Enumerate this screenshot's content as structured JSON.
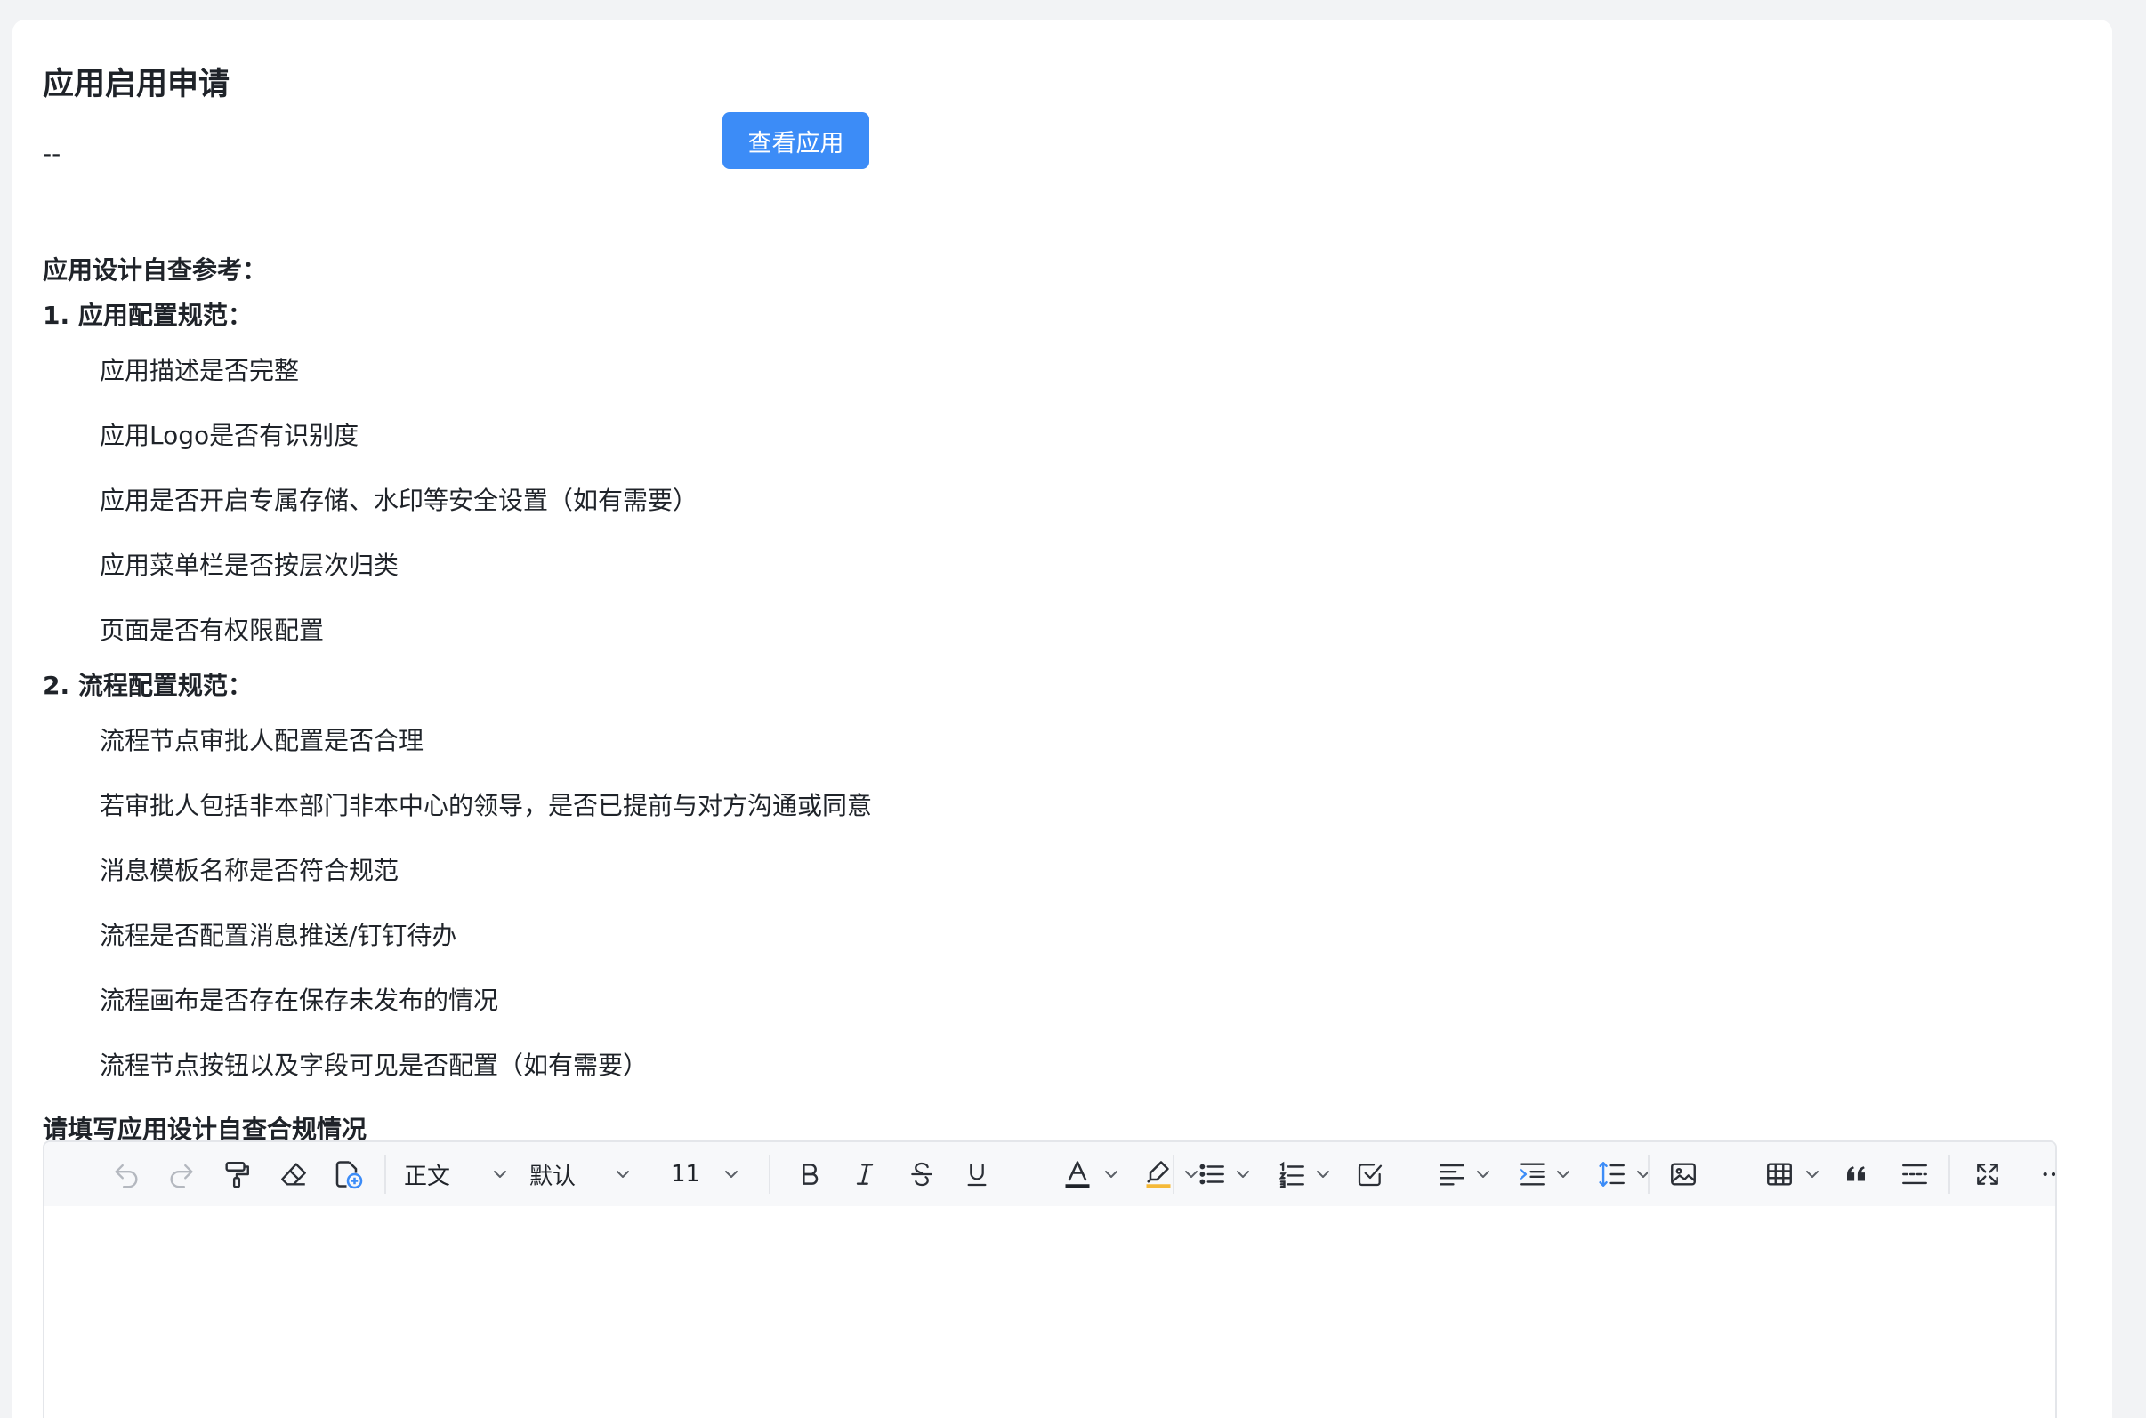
{
  "page": {
    "title": "应用启用申请",
    "app_value": "--",
    "view_button_label": "查看应用"
  },
  "checklist": {
    "heading": "应用设计自查参考：",
    "sections": [
      {
        "title": "1. 应用配置规范：",
        "items": [
          "应用描述是否完整",
          "应用Logo是否有识别度",
          "应用是否开启专属存储、水印等安全设置（如有需要）",
          "应用菜单栏是否按层次归类",
          "页面是否有权限配置"
        ]
      },
      {
        "title": "2. 流程配置规范：",
        "items": [
          "流程节点审批人配置是否合理",
          "若审批人包括非本部门非本中心的领导，是否已提前与对方沟通或同意",
          "消息模板名称是否符合规范",
          "流程是否配置消息推送/钉钉待办",
          "流程画布是否存在保存未发布的情况",
          "流程节点按钮以及字段可见是否配置（如有需要）"
        ]
      }
    ]
  },
  "form": {
    "field_label": "请填写应用设计自查合规情况"
  },
  "editor_toolbar": {
    "paragraph_style": "正文",
    "font_family": "默认",
    "font_size": "11",
    "text_color": "#1f2329",
    "highlight_color": "#f5b938"
  },
  "colors": {
    "primary": "#3c8cf7",
    "page_bg": "#f2f3f5",
    "text": "#1f2329"
  }
}
